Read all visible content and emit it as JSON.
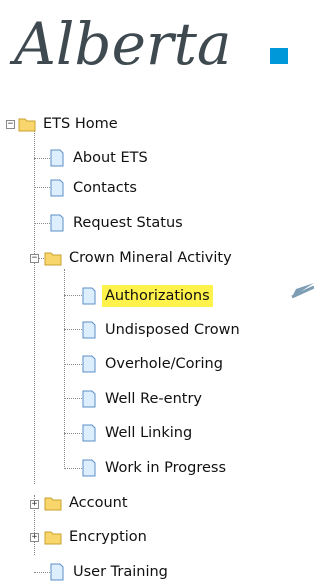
{
  "logo": {
    "text": "Alberta",
    "accent_color": "#0098d8"
  },
  "tree": {
    "root": "ETS Home",
    "items": {
      "about": "About ETS",
      "contacts": "Contacts",
      "request_status": "Request Status",
      "crown": "Crown Mineral Activity",
      "authorizations": "Authorizations",
      "undisposed": "Undisposed Crown",
      "overhole": "Overhole/Coring",
      "reentry": "Well Re-entry",
      "linking": "Well Linking",
      "wip": "Work in Progress",
      "account": "Account",
      "encryption": "Encryption",
      "training": "User Training"
    },
    "toggle": {
      "expanded": "−",
      "collapsed": "+"
    },
    "highlight_color": "#fff24a"
  }
}
